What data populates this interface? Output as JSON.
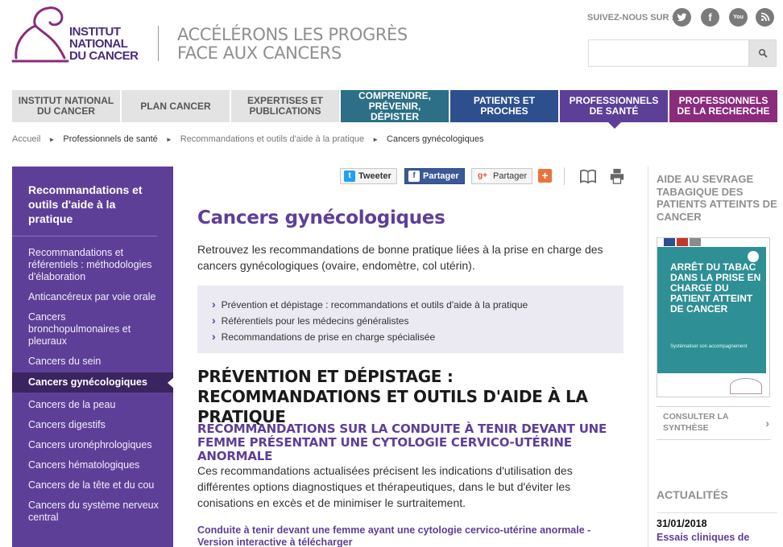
{
  "header": {
    "logo": [
      "INSTITUT",
      "NATIONAL",
      "DU CANCER"
    ],
    "tagline": [
      "ACCÉLÉRONS LES PROGRÈS",
      "FACE AUX CANCERS"
    ],
    "follow_label": "SUIVEZ-NOUS SUR :",
    "social": [
      "twitter-icon",
      "facebook-icon",
      "youtube-icon",
      "rss-icon"
    ],
    "search_placeholder": ""
  },
  "nav": {
    "items": [
      {
        "label": "INSTITUT NATIONAL DU CANCER"
      },
      {
        "label": "PLAN CANCER"
      },
      {
        "label": "EXPERTISES ET PUBLICATIONS"
      },
      {
        "label": "COMPRENDRE, PRÉVENIR, DÉPISTER"
      },
      {
        "label": "PATIENTS ET PROCHES"
      },
      {
        "label": "PROFESSIONNELS DE SANTÉ"
      },
      {
        "label": "PROFESSIONNELS DE LA RECHERCHE"
      }
    ]
  },
  "breadcrumb": {
    "items": [
      "Accueil",
      "Professionnels de santé",
      "Recommandations et outils d'aide à la pratique",
      "Cancers gynécologiques"
    ]
  },
  "sidebar": {
    "title": "Recommandations et outils d'aide à la pratique",
    "items": [
      {
        "label": "Recommandations et référentiels : méthodologies d'élaboration"
      },
      {
        "label": "Anticancéreux par voie orale"
      },
      {
        "label": "Cancers bronchopulmonaires et pleuraux"
      },
      {
        "label": "Cancers du sein"
      },
      {
        "label": "Cancers gynécologiques"
      },
      {
        "label": "Cancers de la peau"
      },
      {
        "label": "Cancers digestifs"
      },
      {
        "label": "Cancers uronéphrologiques"
      },
      {
        "label": "Cancers hématologiques"
      },
      {
        "label": "Cancers de la tête et du cou"
      },
      {
        "label": "Cancers du système nerveux central"
      }
    ]
  },
  "share": {
    "tweet": "Tweeter",
    "facebook": "Partager",
    "google": "Partager",
    "plus": "+"
  },
  "main": {
    "title": "Cancers gynécologiques",
    "intro": "Retrouvez les recommandations de bonne pratique liées à la prise en charge des cancers gynécologiques (ovaire, endomètre, col utérin).",
    "toc": [
      "Prévention et dépistage : recommandations et outils d'aide à la pratique",
      "Référentiels pour les médecins généralistes",
      "Recommandations de prise en charge spécialisée"
    ],
    "section_title": "PRÉVENTION ET DÉPISTAGE : RECOMMANDATIONS ET OUTILS D'AIDE À LA PRATIQUE",
    "sub_title": "RECOMMANDATIONS SUR LA CONDUITE À TENIR DEVANT UNE FEMME PRÉSENTANT UNE CYTOLOGIE CERVICO-UTÉRINE ANORMALE",
    "body": "Ces recommandations actualisées précisent les indications d'utilisation des différentes options diagnostiques et thérapeutiques, dans le but d'éviter les conisations en excès et de minimiser le surtraitement.",
    "doc_link": "Conduite à tenir devant une femme ayant une cytologie cervico-utérine anormale - Version interactive à télécharger"
  },
  "right": {
    "promo_title": "AIDE AU SEVRAGE TABAGIQUE DES PATIENTS ATTEINTS DE CANCER",
    "book_title": "ARRÊT DU TABAC DANS LA PRISE EN CHARGE DU PATIENT ATTEINT DE CANCER",
    "book_subtitle": "Systématiser son accompagnement",
    "consult": "CONSULTER LA SYNTHÈSE",
    "news_title": "ACTUALITÉS",
    "news_date": "31/01/2018",
    "news_text": "Essais cliniques de"
  },
  "colors": {
    "purple": "#5e3f98",
    "teal": "#2c6f86",
    "blue": "#2d4f8d",
    "magenta": "#8b2b7c",
    "book_teal": "#2e8f94"
  }
}
